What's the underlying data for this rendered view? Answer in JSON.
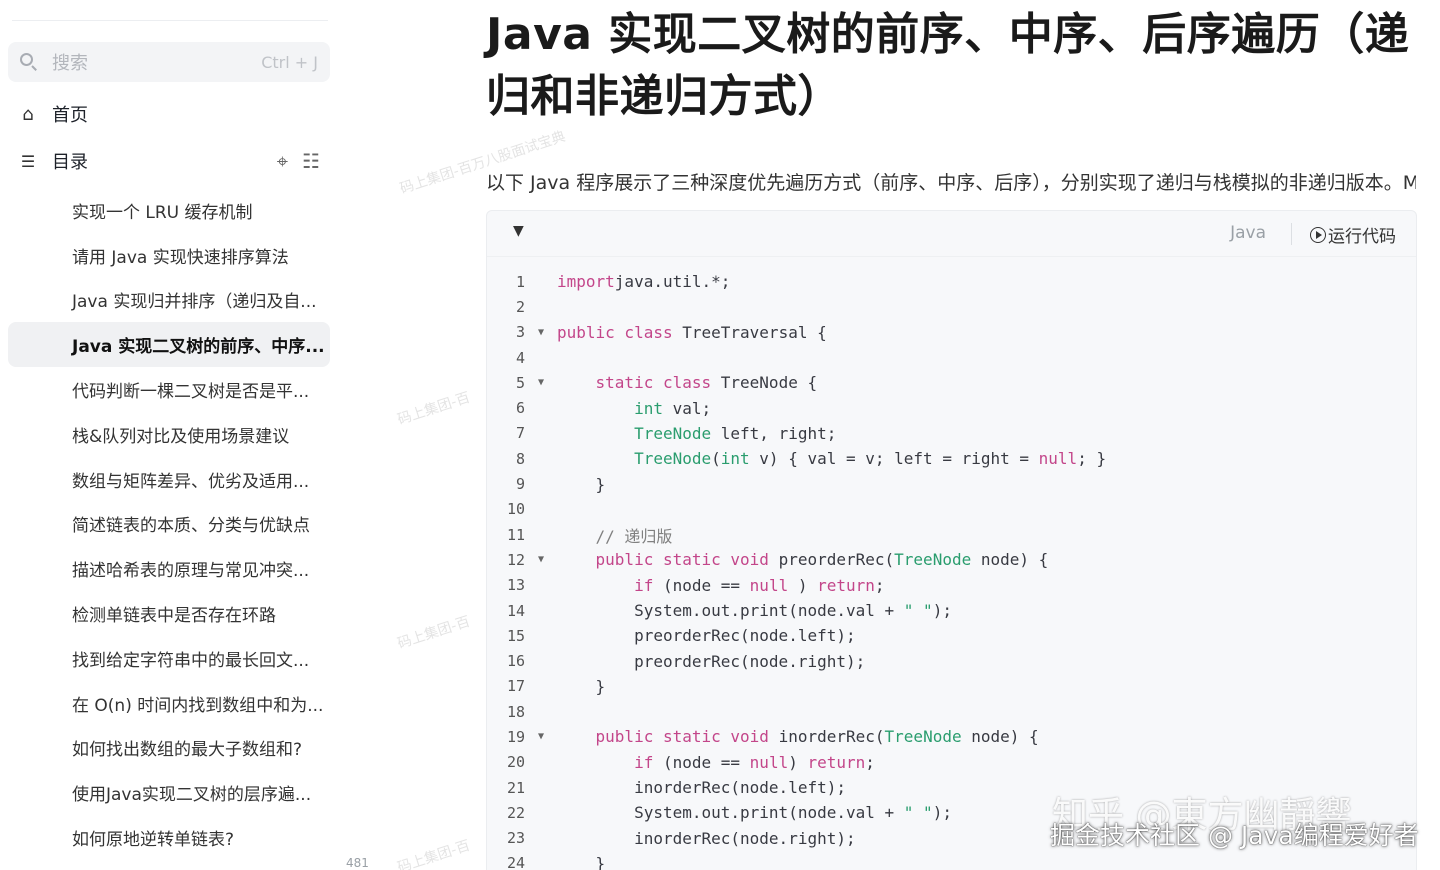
{
  "sidebar": {
    "search": {
      "placeholder": "搜索",
      "shortcut": "Ctrl + J"
    },
    "home_label": "首页",
    "toc_label": "目录",
    "toc_items": [
      "实现一个 LRU 缓存机制",
      "请用 Java 实现快速排序算法",
      "Java 实现归并排序（递归及自...",
      "Java 实现二叉树的前序、中序...",
      "代码判断一棵二叉树是否是平...",
      "栈&队列对比及使用场景建议",
      "数组与矩阵差异、优劣及适用...",
      "简述链表的本质、分类与优缺点",
      "描述哈希表的原理与常见冲突...",
      "检测单链表中是否存在环路",
      "找到给定字符串中的最长回文...",
      "在 O(n) 时间内找到数组中和为...",
      "如何找出数组的最大子数组和?",
      "使用Java实现二叉树的层序遍...",
      "如何原地逆转单链表?"
    ],
    "active_index": 3,
    "word_count": "481字"
  },
  "article": {
    "title_line1": "Java 实现二叉树的前序、中序、后序遍历（递",
    "title_line2": "归和非递归方式）",
    "intro": "以下 Java 程序展示了三种深度优先遍历方式（前序、中序、后序），分别实现了递归与栈模拟的非递归版本。M"
  },
  "code_block": {
    "language": "Java",
    "run_label": "运行代码",
    "lines": [
      {
        "n": "1",
        "fold": false,
        "tokens": [
          [
            "kw",
            "import"
          ],
          [
            "",
            "java.util.*;"
          ]
        ]
      },
      {
        "n": "2",
        "fold": false,
        "tokens": []
      },
      {
        "n": "3",
        "fold": true,
        "tokens": [
          [
            "kw",
            "public class "
          ],
          [
            "",
            "TreeTraversal {"
          ]
        ]
      },
      {
        "n": "4",
        "fold": false,
        "tokens": []
      },
      {
        "n": "5",
        "fold": true,
        "tokens": [
          [
            "",
            "    "
          ],
          [
            "kw",
            "static class "
          ],
          [
            "",
            "TreeNode {"
          ]
        ]
      },
      {
        "n": "6",
        "fold": false,
        "tokens": [
          [
            "",
            "        "
          ],
          [
            "ty",
            "int "
          ],
          [
            "",
            "val;"
          ]
        ]
      },
      {
        "n": "7",
        "fold": false,
        "tokens": [
          [
            "",
            "        "
          ],
          [
            "ty",
            "TreeNode "
          ],
          [
            "",
            "left, right;"
          ]
        ]
      },
      {
        "n": "8",
        "fold": false,
        "tokens": [
          [
            "",
            "        "
          ],
          [
            "ty",
            "TreeNode"
          ],
          [
            "",
            "("
          ],
          [
            "ty",
            "int "
          ],
          [
            "",
            "v) { val = v; left = right = "
          ],
          [
            "lit",
            "null"
          ],
          [
            "",
            "; }"
          ]
        ]
      },
      {
        "n": "9",
        "fold": false,
        "tokens": [
          [
            "",
            "    }"
          ]
        ]
      },
      {
        "n": "10",
        "fold": false,
        "tokens": []
      },
      {
        "n": "11",
        "fold": false,
        "tokens": [
          [
            "",
            "    "
          ],
          [
            "cm",
            "// 递归版"
          ]
        ]
      },
      {
        "n": "12",
        "fold": true,
        "tokens": [
          [
            "",
            "    "
          ],
          [
            "kw",
            "public static void "
          ],
          [
            "",
            "preorderRec("
          ],
          [
            "ty",
            "TreeNode "
          ],
          [
            "",
            "node) {"
          ]
        ]
      },
      {
        "n": "13",
        "fold": false,
        "tokens": [
          [
            "",
            "        "
          ],
          [
            "kw",
            "if "
          ],
          [
            "",
            "(node == "
          ],
          [
            "lit",
            "null"
          ],
          [
            "",
            " ) "
          ],
          [
            "kw",
            "return"
          ],
          [
            "",
            ";"
          ]
        ]
      },
      {
        "n": "14",
        "fold": false,
        "tokens": [
          [
            "",
            "        System.out.print(node.val + "
          ],
          [
            "str",
            "\" \""
          ],
          [
            "",
            ");"
          ]
        ]
      },
      {
        "n": "15",
        "fold": false,
        "tokens": [
          [
            "",
            "        preorderRec(node.left);"
          ]
        ]
      },
      {
        "n": "16",
        "fold": false,
        "tokens": [
          [
            "",
            "        preorderRec(node.right);"
          ]
        ]
      },
      {
        "n": "17",
        "fold": false,
        "tokens": [
          [
            "",
            "    }"
          ]
        ]
      },
      {
        "n": "18",
        "fold": false,
        "tokens": []
      },
      {
        "n": "19",
        "fold": true,
        "tokens": [
          [
            "",
            "    "
          ],
          [
            "kw",
            "public static void "
          ],
          [
            "",
            "inorderRec("
          ],
          [
            "ty",
            "TreeNode "
          ],
          [
            "",
            "node) {"
          ]
        ]
      },
      {
        "n": "20",
        "fold": false,
        "tokens": [
          [
            "",
            "        "
          ],
          [
            "kw",
            "if "
          ],
          [
            "",
            "(node == "
          ],
          [
            "lit",
            "null"
          ],
          [
            "",
            ") "
          ],
          [
            "kw",
            "return"
          ],
          [
            "",
            ";"
          ]
        ]
      },
      {
        "n": "21",
        "fold": false,
        "tokens": [
          [
            "",
            "        inorderRec(node.left);"
          ]
        ]
      },
      {
        "n": "22",
        "fold": false,
        "tokens": [
          [
            "",
            "        System.out.print(node.val + "
          ],
          [
            "str",
            "\" \""
          ],
          [
            "",
            ");"
          ]
        ]
      },
      {
        "n": "23",
        "fold": false,
        "tokens": [
          [
            "",
            "        inorderRec(node.right);"
          ]
        ]
      },
      {
        "n": "24",
        "fold": false,
        "tokens": [
          [
            "",
            "    }"
          ]
        ]
      }
    ]
  },
  "watermarks": {
    "faint": [
      "码上集团-百万八股面试宝典",
      "码上集团-百",
      "码上集团-百",
      "码上集团-百"
    ],
    "zhihu": "知乎 @東方幽靜響",
    "juejin": "掘金技术社区 @ Java编程爱好者"
  }
}
